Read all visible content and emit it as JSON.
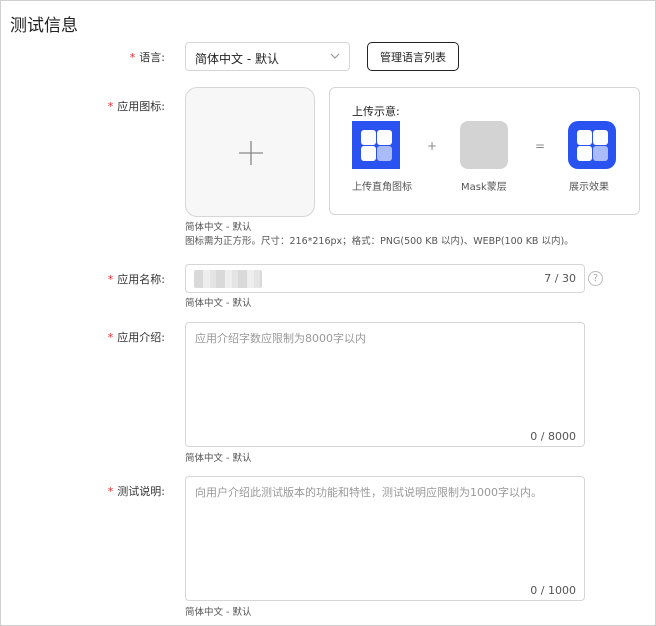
{
  "page": {
    "title": "测试信息"
  },
  "language": {
    "label": "语言:",
    "selected": "简体中文 - 默认",
    "manage_button": "管理语言列表"
  },
  "app_icon": {
    "label": "应用图标:",
    "example": {
      "title": "上传示意:",
      "plus": "+",
      "equals": "=",
      "captions": [
        "上传直角图标",
        "Mask蒙层",
        "展示效果"
      ]
    },
    "hint_locale": "简体中文 - 默认",
    "hint_spec": "图标需为正方形。尺寸：216*216px；格式：PNG(500 KB 以内)、WEBP(100 KB 以内)。"
  },
  "app_name": {
    "label": "应用名称:",
    "counter": "7 / 30",
    "help": "?",
    "hint_locale": "简体中文 - 默认"
  },
  "app_intro": {
    "label": "应用介绍:",
    "placeholder": "应用介绍字数应限制为8000字以内",
    "counter": "0 / 8000",
    "hint_locale": "简体中文 - 默认"
  },
  "test_desc": {
    "label": "测试说明:",
    "placeholder": "向用户介绍此测试版本的功能和特性，测试说明应限制为1000字以内。",
    "counter": "0 / 1000",
    "hint_locale": "简体中文 - 默认"
  },
  "colors": {
    "required": "#e6262e",
    "icon_blue": "#2a52f0",
    "border": "#d6d6d6"
  }
}
